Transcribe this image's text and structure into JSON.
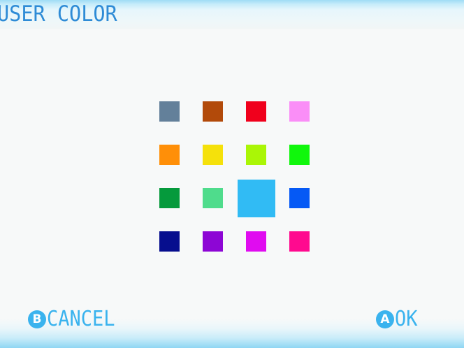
{
  "header": {
    "title": "USER COLOR"
  },
  "palette": {
    "selected_index": 10,
    "colors": [
      "#63809a",
      "#b24a0a",
      "#f0001c",
      "#fa8ef7",
      "#ff8f08",
      "#f5e10b",
      "#aaf606",
      "#10f70c",
      "#059a3c",
      "#4fdc8c",
      "#31bbf4",
      "#0559f5",
      "#060e8e",
      "#8d06d5",
      "#e00cf0",
      "#ff0a8f"
    ]
  },
  "footer": {
    "cancel": {
      "icon_glyph": "B",
      "label": "CANCEL"
    },
    "ok": {
      "icon_glyph": "A",
      "label": "OK"
    }
  }
}
